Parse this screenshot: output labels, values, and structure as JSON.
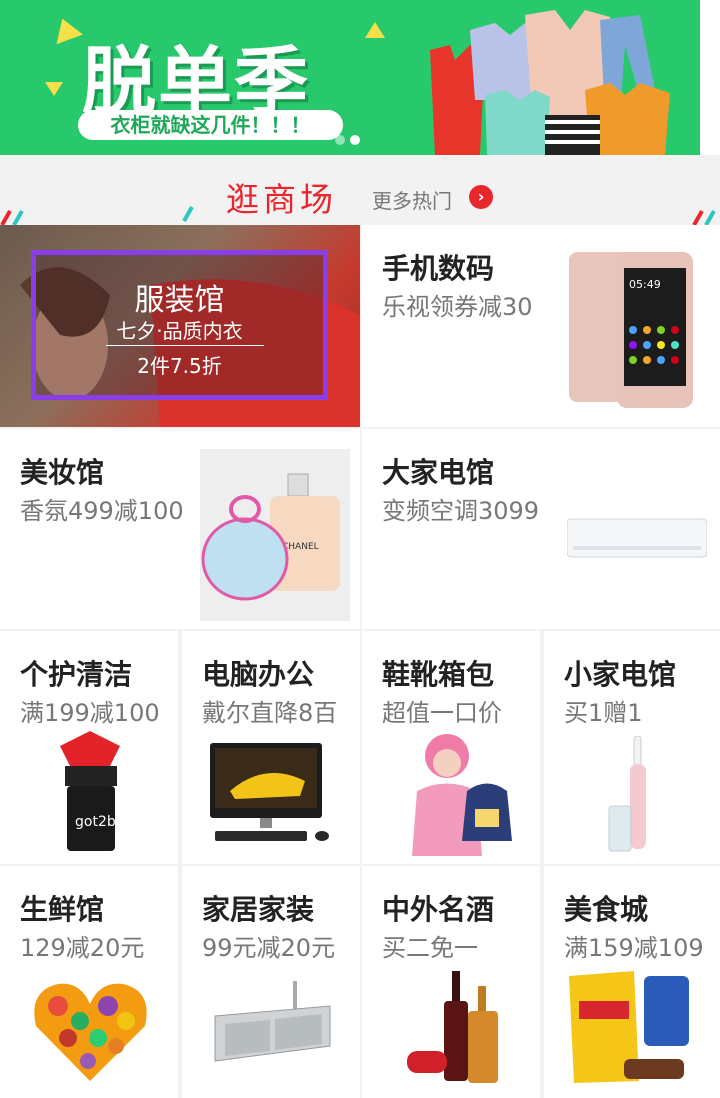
{
  "banner": {
    "headline": "脱单季",
    "tagline": "衣柜就缺这几件！！！"
  },
  "section": {
    "title": "逛商场",
    "more_label": "更多热门",
    "more_icon": "chevron-right-icon"
  },
  "hero": {
    "title": "服装馆",
    "subtitle": "七夕·品质内衣",
    "promo": "2件7.5折"
  },
  "tiles": [
    {
      "title": "手机数码",
      "sub": "乐视领券减30"
    },
    {
      "title": "美妆馆",
      "sub": "香氛499减100"
    },
    {
      "title": "大家电馆",
      "sub": "变频空调3099"
    },
    {
      "title": "个护清洁",
      "sub": "满199减100"
    },
    {
      "title": "电脑办公",
      "sub": "戴尔直降8百"
    },
    {
      "title": "鞋靴箱包",
      "sub": "超值一口价"
    },
    {
      "title": "小家电馆",
      "sub": "买1赠1"
    },
    {
      "title": "生鲜馆",
      "sub": "129减20元"
    },
    {
      "title": "家居家装",
      "sub": "99元减20元"
    },
    {
      "title": "中外名酒",
      "sub": "买二免一"
    },
    {
      "title": "美食城",
      "sub": "满159减109"
    }
  ],
  "colors": {
    "banner_green": "#27c96c",
    "accent_red": "#e8262e",
    "frame_purple": "#8a3ee8"
  }
}
